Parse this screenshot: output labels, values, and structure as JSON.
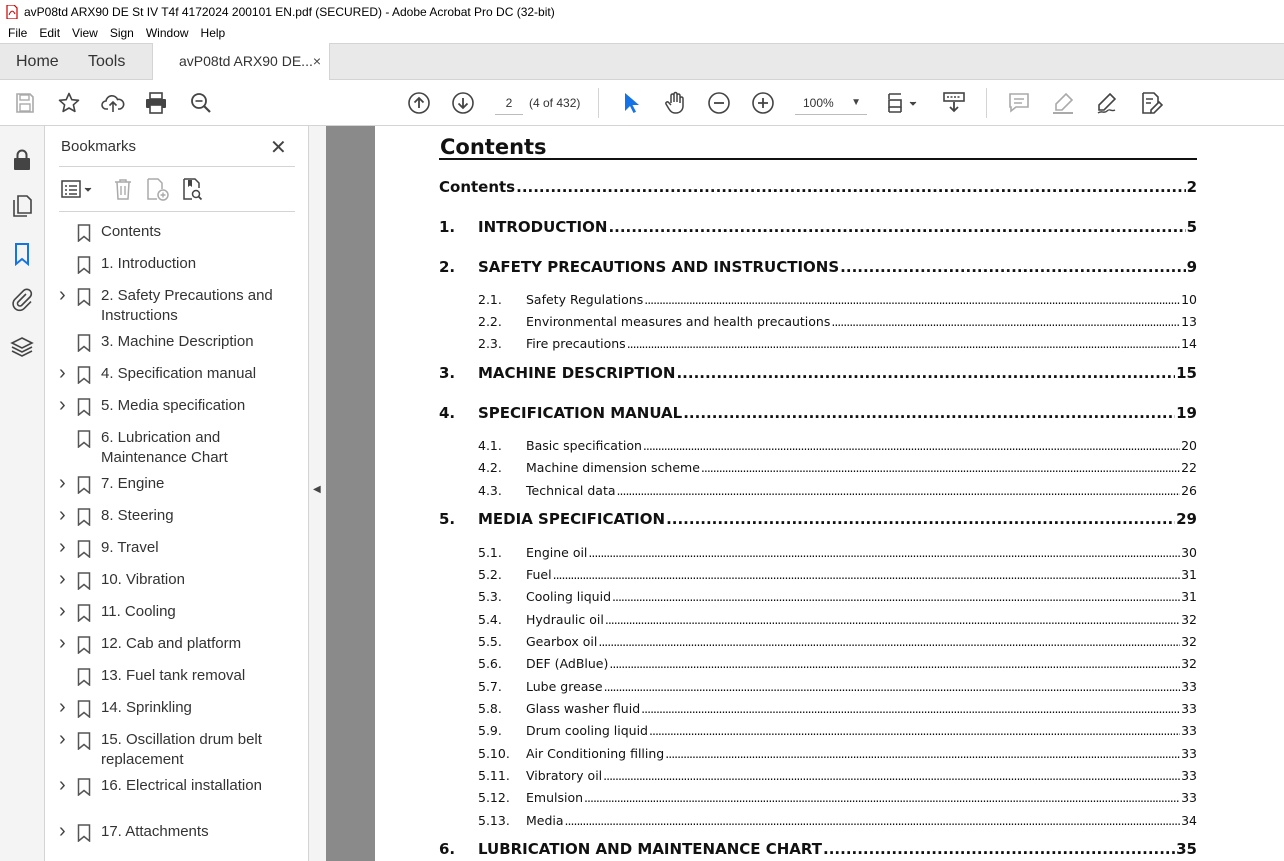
{
  "window": {
    "title": "avP08td ARX90 DE St IV T4f 4172024 200101 EN.pdf (SECURED) - Adobe Acrobat Pro DC (32-bit)"
  },
  "menu": [
    "File",
    "Edit",
    "View",
    "Sign",
    "Window",
    "Help"
  ],
  "tabs": {
    "home": "Home",
    "tools": "Tools",
    "document": "avP08td ARX90 DE...",
    "close": "×"
  },
  "toolbar": {
    "page_current": "2",
    "page_count": "(4 of 432)",
    "zoom": "100%",
    "icons": [
      "save-icon",
      "bookmark-star-icon",
      "upload-icon",
      "print-icon",
      "search-zoom-icon",
      "prev-page-icon",
      "next-page-icon",
      "select-cursor-icon",
      "hand-tool-icon",
      "zoom-out-icon",
      "zoom-in-icon",
      "page-fit-icon",
      "scroll-mode-icon",
      "comment-icon",
      "highlight-icon",
      "draw-sign-icon",
      "fill-sign-icon"
    ]
  },
  "left_rail": {
    "icons": [
      "lock-icon",
      "pages-icon",
      "bookmark-icon",
      "attachment-icon",
      "layers-icon"
    ]
  },
  "bookmarks": {
    "header": "Bookmarks",
    "close": "✕",
    "items": [
      {
        "label": "Contents",
        "expandable": false
      },
      {
        "label": "1. Introduction",
        "expandable": false
      },
      {
        "label": "2. Safety Precautions and Instructions",
        "expandable": true
      },
      {
        "label": "3. Machine Description",
        "expandable": false
      },
      {
        "label": "4. Specification manual",
        "expandable": true
      },
      {
        "label": "5. Media specification",
        "expandable": true
      },
      {
        "label": "6. Lubrication and Maintenance Chart",
        "expandable": false
      },
      {
        "label": "7. Engine",
        "expandable": true
      },
      {
        "label": "8. Steering",
        "expandable": true
      },
      {
        "label": "9. Travel",
        "expandable": true
      },
      {
        "label": "10. Vibration",
        "expandable": true
      },
      {
        "label": "11. Cooling",
        "expandable": true
      },
      {
        "label": "12. Cab and platform",
        "expandable": true
      },
      {
        "label": "13. Fuel tank removal",
        "expandable": false
      },
      {
        "label": "14. Sprinkling",
        "expandable": true
      },
      {
        "label": "15. Oscillation drum belt replacement",
        "expandable": true
      },
      {
        "label": "16. Electrical installation",
        "expandable": true
      },
      {
        "label": "17. Attachments",
        "expandable": true
      }
    ]
  },
  "document": {
    "title": "Contents",
    "toc": [
      {
        "level": 0,
        "num": "",
        "text": "Contents",
        "page": "2"
      },
      {
        "level": 1,
        "num": "1.",
        "text": "INTRODUCTION",
        "page": "5"
      },
      {
        "level": 1,
        "num": "2.",
        "text": "SAFETY PRECAUTIONS AND INSTRUCTIONS",
        "page": "9"
      },
      {
        "level": 2,
        "num": "2.1.",
        "text": "Safety Regulations",
        "page": "10"
      },
      {
        "level": 2,
        "num": "2.2.",
        "text": "Environmental measures and health precautions",
        "page": "13"
      },
      {
        "level": 2,
        "num": "2.3.",
        "text": "Fire precautions",
        "page": "14"
      },
      {
        "level": 1,
        "num": "3.",
        "text": "MACHINE DESCRIPTION",
        "page": "15"
      },
      {
        "level": 1,
        "num": "4.",
        "text": "SPECIFICATION MANUAL",
        "page": "19"
      },
      {
        "level": 2,
        "num": "4.1.",
        "text": "Basic specification",
        "page": "20"
      },
      {
        "level": 2,
        "num": "4.2.",
        "text": "Machine dimension scheme",
        "page": "22"
      },
      {
        "level": 2,
        "num": "4.3.",
        "text": "Technical data",
        "page": "26"
      },
      {
        "level": 1,
        "num": "5.",
        "text": "MEDIA SPECIFICATION",
        "page": "29"
      },
      {
        "level": 2,
        "num": "5.1.",
        "text": "Engine oil",
        "page": "30"
      },
      {
        "level": 2,
        "num": "5.2.",
        "text": "Fuel",
        "page": "31"
      },
      {
        "level": 2,
        "num": "5.3.",
        "text": "Cooling liquid",
        "page": "31"
      },
      {
        "level": 2,
        "num": "5.4.",
        "text": "Hydraulic oil",
        "page": "32"
      },
      {
        "level": 2,
        "num": "5.5.",
        "text": "Gearbox oil",
        "page": "32"
      },
      {
        "level": 2,
        "num": "5.6.",
        "text": "DEF (AdBlue)",
        "page": "32"
      },
      {
        "level": 2,
        "num": "5.7.",
        "text": "Lube grease",
        "page": "33"
      },
      {
        "level": 2,
        "num": "5.8.",
        "text": "Glass washer fluid",
        "page": "33"
      },
      {
        "level": 2,
        "num": "5.9.",
        "text": "Drum cooling liquid",
        "page": "33"
      },
      {
        "level": 2,
        "num": "5.10.",
        "text": "Air Conditioning filling",
        "page": "33"
      },
      {
        "level": 2,
        "num": "5.11.",
        "text": "Vibratory oil",
        "page": "33"
      },
      {
        "level": 2,
        "num": "5.12.",
        "text": "Emulsion",
        "page": "33"
      },
      {
        "level": 2,
        "num": "5.13.",
        "text": "Media",
        "page": "34"
      },
      {
        "level": 1,
        "num": "6.",
        "text": "LUBRICATION AND MAINTENANCE CHART",
        "page": "35"
      }
    ]
  },
  "colors": {
    "accent": "#1473e6",
    "doc_background": "#8a8a8a",
    "chrome": "#e9e9e9"
  }
}
